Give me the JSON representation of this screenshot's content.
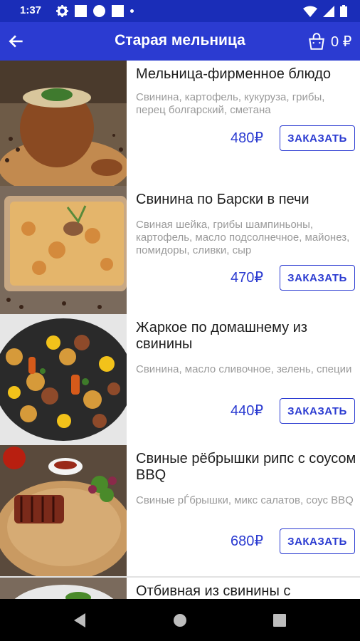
{
  "status_bar": {
    "time": "1:37"
  },
  "app_bar": {
    "title": "Старая мельница",
    "cart_total": "0 ₽"
  },
  "colors": {
    "primary": "#2b3bd1",
    "status_bar": "#1a2db8"
  },
  "menu_items": [
    {
      "name": "Мельница-фирменное блюдо",
      "description": "Свинина, картофель, кукуруза, грибы, перец болгарский, сметана",
      "price": "480₽",
      "button": "ЗАКАЗАТЬ"
    },
    {
      "name": "Свинина по Барски в печи",
      "description": "Свиная шейка, грибы шампиньоны, картофель, масло подсолнечное, майонез, помидоры, сливки, сыр",
      "price": "470₽",
      "button": "ЗАКАЗАТЬ"
    },
    {
      "name": "Жаркое по домашнему из свинины",
      "description": "Свинина, масло сливочное, зелень, специи",
      "price": "440₽",
      "button": "ЗАКАЗАТЬ"
    },
    {
      "name": "Свиные рёбрышки рипс с соусом BBQ",
      "description": "Свиные рЃбрышки, микс салатов, соус BBQ",
      "price": "680₽",
      "button": "ЗАКАЗАТЬ"
    },
    {
      "name": "Отбивная из свинины с",
      "description": "",
      "price": "",
      "button": ""
    }
  ]
}
